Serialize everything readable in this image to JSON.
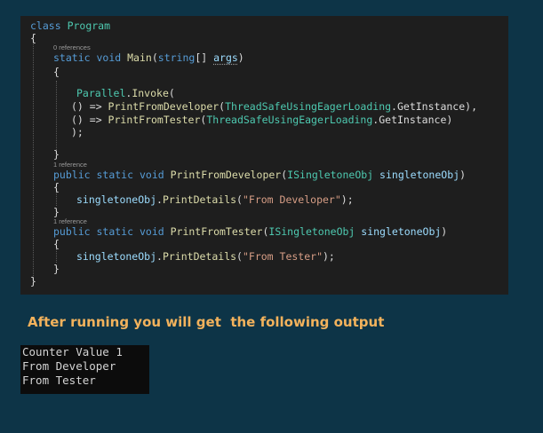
{
  "code": {
    "class_keyword": "class",
    "class_name": "Program",
    "open_brace": "{",
    "close_brace": "}",
    "method_open_brace": "{",
    "method_close_brace": "}",
    "main": {
      "references": "0 references",
      "static_kw": "static",
      "void_kw": "void",
      "name": "Main",
      "open_paren": "(",
      "string_kw": "string",
      "brackets": "[] ",
      "param": "args",
      "close_paren": ")",
      "body_open": "{",
      "body_close": "}",
      "invoke_type": "Parallel",
      "invoke_dot": ".",
      "invoke_method": "Invoke",
      "invoke_paren": "(",
      "lambda_arrow": "() => ",
      "call1_method": "PrintFromDeveloper",
      "call2_method": "PrintFromTester",
      "call_open": "(",
      "call_type": "ThreadSafeUsingEagerLoading",
      "call_dot": ".",
      "call_getinstance": "GetInstance",
      "call1_close": "),",
      "call2_close": ")",
      "invoke_close": ");"
    },
    "dev": {
      "references": "1 reference",
      "public_kw": "public",
      "static_kw": "static",
      "void_kw": "void",
      "name": "PrintFromDeveloper",
      "open_paren": "(",
      "param_type": "ISingletoneObj",
      "param_name": "singletoneObj",
      "close_paren": ")",
      "body_obj": "singletoneObj",
      "body_dot": ".",
      "body_method": "PrintDetails",
      "body_open": "(",
      "body_string": "\"From Developer\"",
      "body_close": ");"
    },
    "tester": {
      "references": "1 reference",
      "public_kw": "public",
      "static_kw": "static",
      "void_kw": "void",
      "name": "PrintFromTester",
      "open_paren": "(",
      "param_type": "ISingletoneObj",
      "param_name": "singletoneObj",
      "close_paren": ")",
      "body_obj": "singletoneObj",
      "body_dot": ".",
      "body_method": "PrintDetails",
      "body_open": "(",
      "body_string": "\"From Tester\"",
      "body_close": ");"
    }
  },
  "heading": "After running you will get  the following output",
  "console": {
    "lines": [
      "Counter Value 1",
      "From Developer",
      "From Tester"
    ]
  },
  "colors": {
    "page_background": "#0d3447",
    "editor_background": "#1e1e1e",
    "console_background": "#0c0c0c",
    "heading": "#f2b25c",
    "keyword": "#569cd6",
    "type": "#4ec9b0",
    "method": "#dcdcaa",
    "string": "#d69d85",
    "parameter": "#9cdcfe",
    "plain": "#dcdcdc"
  }
}
